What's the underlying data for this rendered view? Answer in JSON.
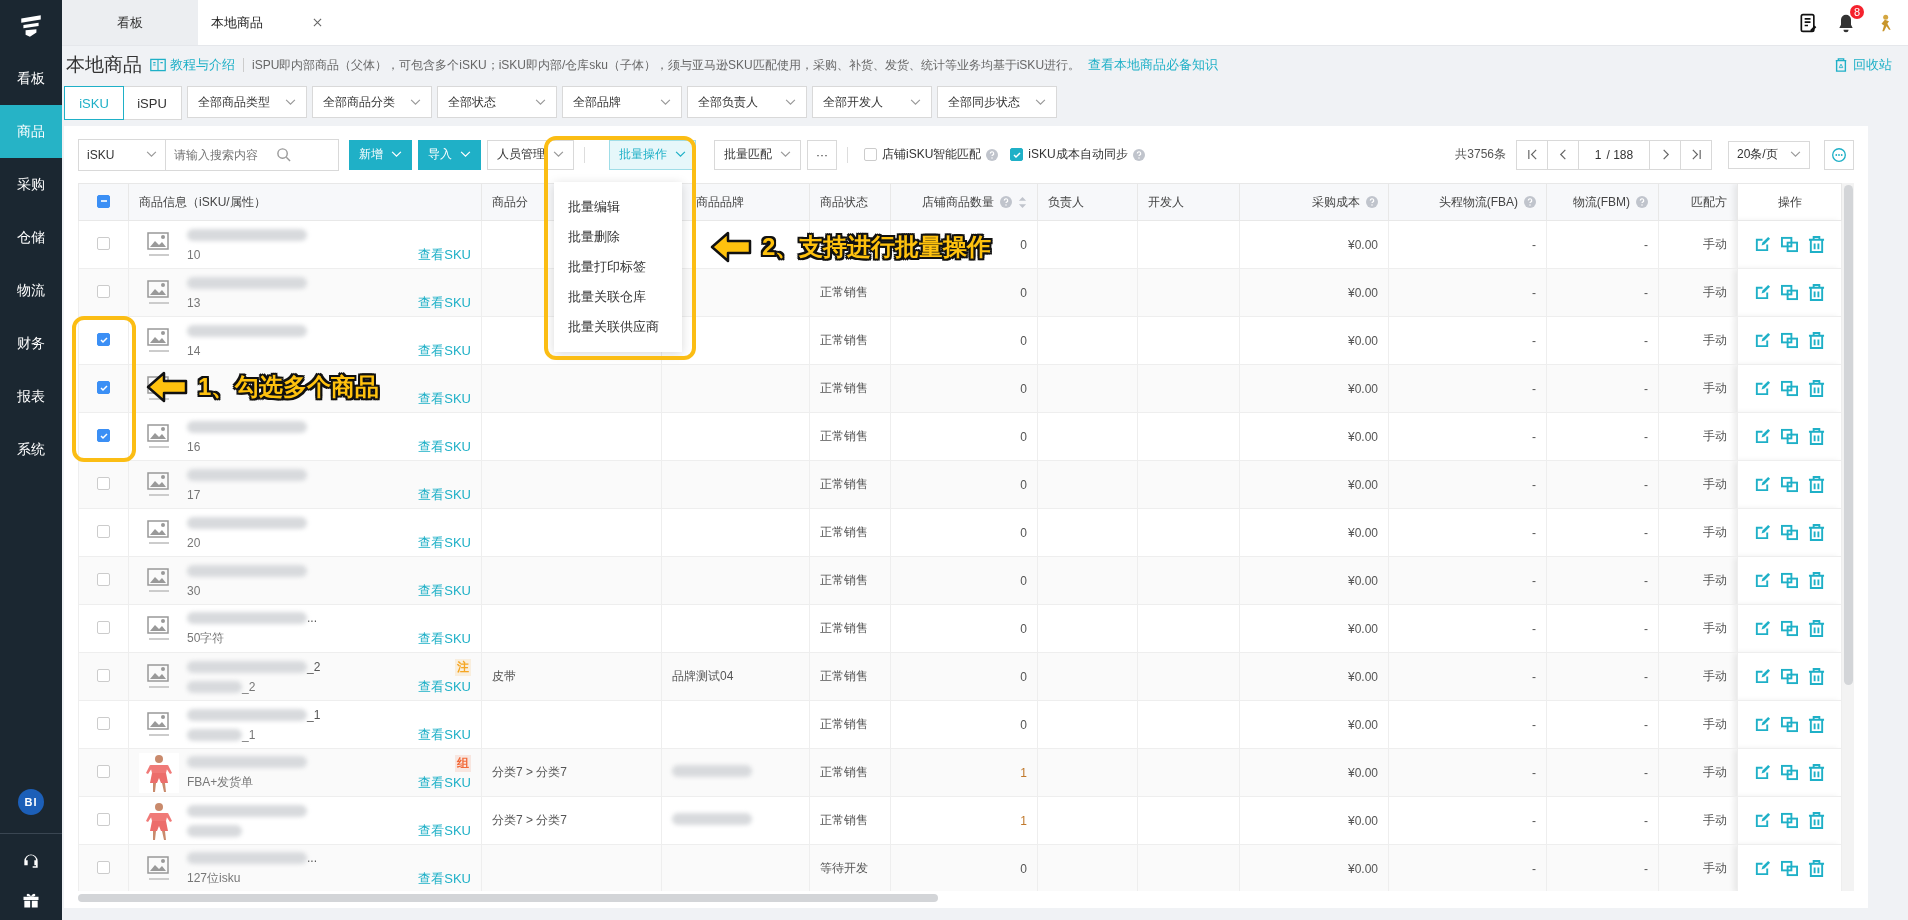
{
  "sidebar": {
    "items": [
      {
        "label": "看板",
        "selected": false
      },
      {
        "label": "商品",
        "selected": true
      },
      {
        "label": "采购",
        "selected": false
      },
      {
        "label": "仓储",
        "selected": false
      },
      {
        "label": "物流",
        "selected": false
      },
      {
        "label": "财务",
        "selected": false
      },
      {
        "label": "报表",
        "selected": false
      },
      {
        "label": "系统",
        "selected": false
      }
    ],
    "bottom_badge": "BI"
  },
  "tabs": [
    {
      "label": "看板",
      "selected": false,
      "closable": false
    },
    {
      "label": "本地商品",
      "selected": true,
      "closable": true
    }
  ],
  "header": {
    "notification_count": "8"
  },
  "page": {
    "title": "本地商品",
    "tutorial_link": "教程与介绍",
    "description": "iSPU即内部商品（父体），可包含多个iSKU；iSKU即内部/仓库sku（子体），须与亚马逊SKU匹配使用，采购、补货、发货、统计等业务均基于iSKU进行。",
    "knowledge_link": "查看本地商品必备知识",
    "recycle_bin": "回收站"
  },
  "view_toggle": [
    {
      "label": "iSKU",
      "selected": true
    },
    {
      "label": "iSPU",
      "selected": false
    }
  ],
  "filters": [
    "全部商品类型",
    "全部商品分类",
    "全部状态",
    "全部品牌",
    "全部负责人",
    "全部开发人",
    "全部同步状态"
  ],
  "toolbar": {
    "search_type": "iSKU",
    "search": {
      "placeholder": "请输入搜索内容"
    },
    "buttons": [
      {
        "label": "新增",
        "kind": "primary",
        "active": false
      },
      {
        "label": "导入",
        "kind": "primary",
        "active": false
      },
      {
        "label": "人员管理",
        "kind": "default",
        "active": false
      },
      {
        "label": "批量操作",
        "kind": "default",
        "active": true
      },
      {
        "label": "批量匹配",
        "kind": "default",
        "active": false
      }
    ],
    "more": "···",
    "options": [
      {
        "label": "店铺iSKU智能匹配",
        "checked": false
      },
      {
        "label": "iSKU成本自动同步",
        "checked": true
      }
    ],
    "total": "共3756条",
    "page": "1",
    "page_count": "/ 188",
    "page_size": "20条/页"
  },
  "batch_menu": {
    "items": [
      "批量编辑",
      "批量删除",
      "批量打印标签",
      "批量关联仓库",
      "批量关联供应商"
    ]
  },
  "table": {
    "header_checkbox": {
      "indeterminate": true
    },
    "columns": [
      {
        "label": "商品信息（iSKU/属性）",
        "help": false,
        "sortable": false
      },
      {
        "label": "商品分",
        "help": false,
        "sortable": false
      },
      {
        "label": "商品品牌",
        "help": false,
        "sortable": false
      },
      {
        "label": "商品状态",
        "help": false,
        "sortable": false
      },
      {
        "label": "店铺商品数量",
        "help": true,
        "sortable": true
      },
      {
        "label": "负责人",
        "help": false,
        "sortable": false
      },
      {
        "label": "开发人",
        "help": false,
        "sortable": false
      },
      {
        "label": "采购成本",
        "help": true,
        "sortable": false
      },
      {
        "label": "头程物流(FBA)",
        "help": true,
        "sortable": false
      },
      {
        "label": "物流(FBM)",
        "help": true,
        "sortable": false
      },
      {
        "label": "匹配方",
        "help": false,
        "sortable": false
      },
      {
        "label": "操作",
        "help": false,
        "sortable": false
      }
    ],
    "rows": [
      {
        "checked": false,
        "kind": "placeholder",
        "name_blurred": true,
        "code": "10",
        "link": "查看SKU",
        "store_count": "0",
        "cost": "¥0.00",
        "fba": "-",
        "fbm": "-",
        "match": "手动"
      },
      {
        "checked": false,
        "kind": "placeholder",
        "name_blurred": true,
        "code": "13",
        "link": "查看SKU",
        "status": "正常销售",
        "store_count": "0",
        "cost": "¥0.00",
        "fba": "-",
        "fbm": "-",
        "match": "手动"
      },
      {
        "checked": true,
        "kind": "placeholder",
        "name_blurred": true,
        "code": "14",
        "link": "查看SKU",
        "status": "正常销售",
        "store_count": "0",
        "cost": "¥0.00",
        "fba": "-",
        "fbm": "-",
        "match": "手动"
      },
      {
        "checked": true,
        "kind": "placeholder",
        "name_blurred": false,
        "link": "查看SKU",
        "status": "正常销售",
        "store_count": "0",
        "cost": "¥0.00",
        "fba": "-",
        "fbm": "-",
        "match": "手动"
      },
      {
        "checked": true,
        "kind": "placeholder",
        "name_blurred": true,
        "code": "16",
        "link": "查看SKU",
        "status": "正常销售",
        "store_count": "0",
        "cost": "¥0.00",
        "fba": "-",
        "fbm": "-",
        "match": "手动"
      },
      {
        "checked": false,
        "kind": "placeholder",
        "name_blurred": true,
        "code": "17",
        "link": "查看SKU",
        "status": "正常销售",
        "store_count": "0",
        "cost": "¥0.00",
        "fba": "-",
        "fbm": "-",
        "match": "手动"
      },
      {
        "checked": false,
        "kind": "placeholder",
        "name_blurred": true,
        "code": "20",
        "link": "查看SKU",
        "status": "正常销售",
        "store_count": "0",
        "cost": "¥0.00",
        "fba": "-",
        "fbm": "-",
        "match": "手动"
      },
      {
        "checked": false,
        "kind": "placeholder",
        "name_blurred": true,
        "code": "30",
        "link": "查看SKU",
        "status": "正常销售",
        "store_count": "0",
        "cost": "¥0.00",
        "fba": "-",
        "fbm": "-",
        "match": "手动"
      },
      {
        "checked": false,
        "kind": "placeholder",
        "name_blurred": true,
        "name": "...",
        "code": "50字符",
        "link": "查看SKU",
        "status": "正常销售",
        "store_count": "0",
        "cost": "¥0.00",
        "fba": "-",
        "fbm": "-",
        "match": "手动"
      },
      {
        "checked": false,
        "kind": "placeholder",
        "name_blurred": true,
        "name": "_2",
        "code_blurred": true,
        "code": "_2",
        "tag": {
          "text": "注",
          "color": "#f5a623"
        },
        "link": "查看SKU",
        "category": "皮带",
        "brand": "品牌测试04",
        "status": "正常销售",
        "store_count": "0",
        "cost": "¥0.00",
        "fba": "-",
        "fbm": "-",
        "match": "手动"
      },
      {
        "checked": false,
        "kind": "placeholder",
        "name_blurred": true,
        "name": "_1",
        "code_blurred": true,
        "code": "_1",
        "link": "查看SKU",
        "status": "正常销售",
        "store_count": "0",
        "cost": "¥0.00",
        "fba": "-",
        "fbm": "-",
        "match": "手动"
      },
      {
        "checked": false,
        "kind": "picture",
        "name_blurred": true,
        "code": "FBA+发货单",
        "tag": {
          "text": "组",
          "color": "#f26b3a"
        },
        "link": "查看SKU",
        "category": "分类7 > 分类7",
        "brand_blurred": true,
        "status": "正常销售",
        "store_count": "1",
        "cost": "¥0.00",
        "fba": "-",
        "fbm": "-",
        "match": "手动"
      },
      {
        "checked": false,
        "kind": "picture",
        "name_blurred": true,
        "code_blurred": true,
        "link": "查看SKU",
        "category": "分类7 > 分类7",
        "brand_blurred": true,
        "status": "正常销售",
        "store_count": "1",
        "cost": "¥0.00",
        "fba": "-",
        "fbm": "-",
        "match": "手动"
      },
      {
        "checked": false,
        "kind": "placeholder",
        "name_blurred": true,
        "name": "...",
        "code": "127位isku",
        "link": "查看SKU",
        "status": "等待开发",
        "store_count": "0",
        "cost": "¥0.00",
        "fba": "-",
        "fbm": "-",
        "match": "手动"
      }
    ]
  },
  "annotations": [
    {
      "label": "1、勾选多个商品"
    },
    {
      "label": "2、支持进行批量操作"
    }
  ]
}
